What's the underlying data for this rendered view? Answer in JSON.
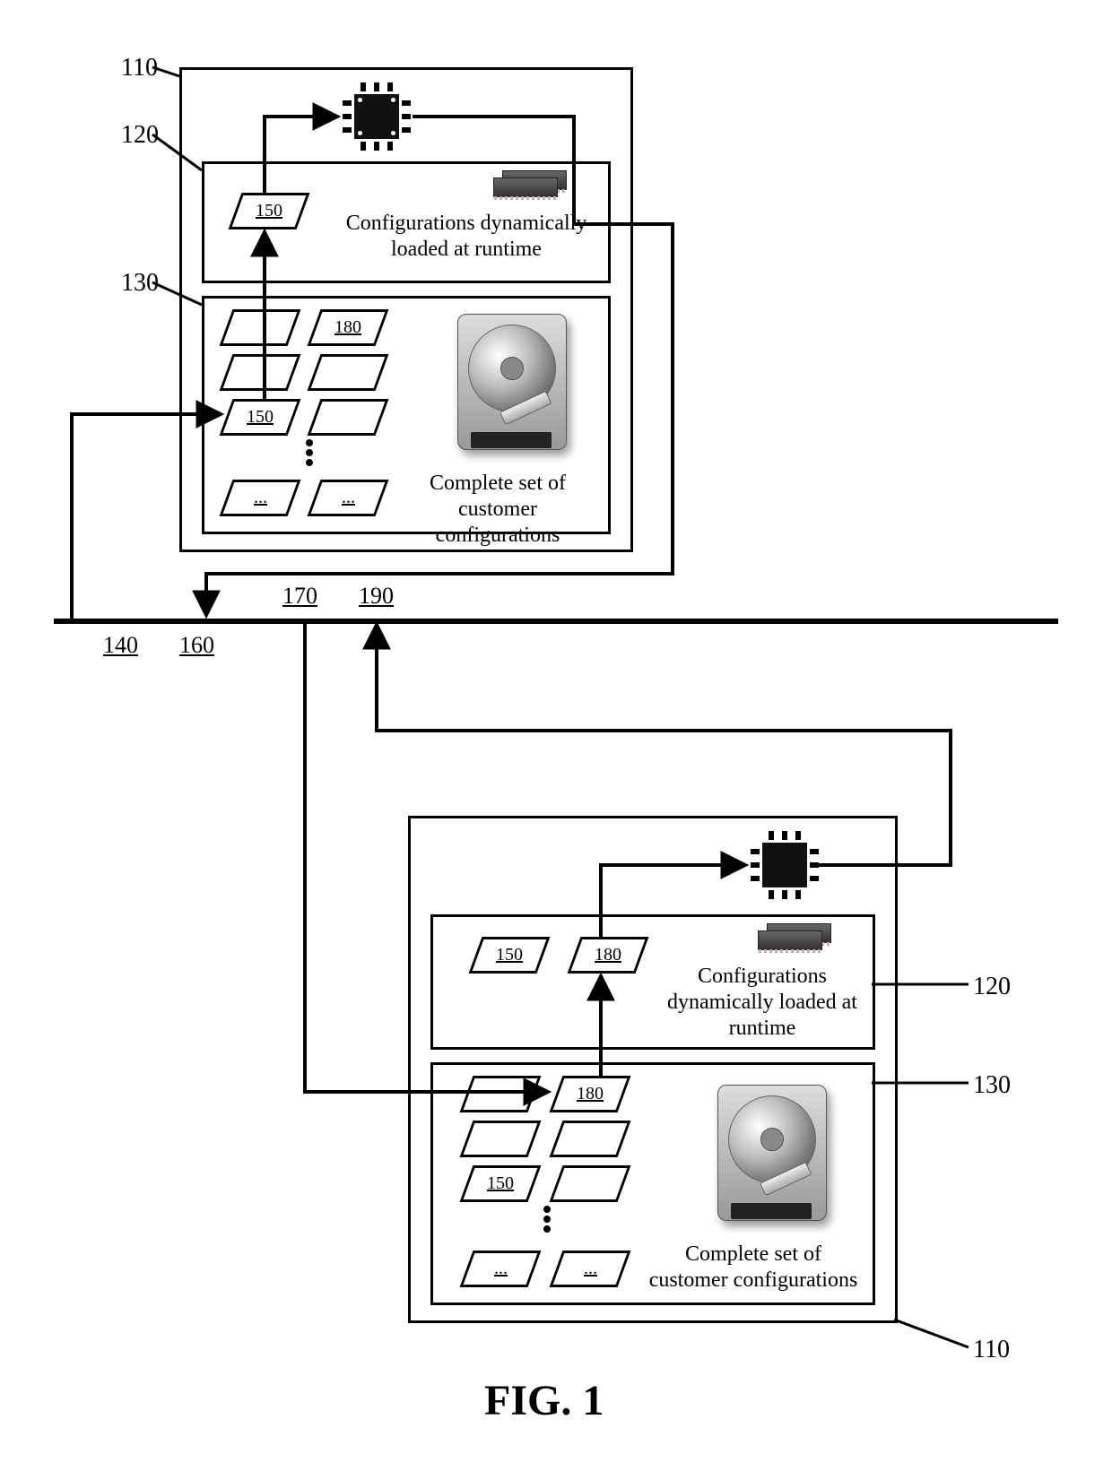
{
  "refs": {
    "r110a": "110",
    "r120a": "120",
    "r130a": "130",
    "r140": "140",
    "r160": "160",
    "r170": "170",
    "r190": "190",
    "r110b": "110",
    "r120b": "120",
    "r130b": "130"
  },
  "paras": {
    "p150_upper_mem": "150",
    "p180_upper_store": "180",
    "p150_upper_store": "150",
    "pdots1": "...",
    "pdots2": "...",
    "p150_lower_mem": "150",
    "p180_lower_mem": "180",
    "p180_lower_store": "180",
    "p150_lower_store": "150",
    "pdots3": "...",
    "pdots4": "..."
  },
  "captions": {
    "mem_upper": "Configurations dynamically\nloaded at runtime",
    "store_upper": "Complete set of\ncustomer configurations",
    "mem_lower": "Configurations\ndynamically loaded at\nruntime",
    "store_lower": "Complete set of\ncustomer configurations"
  },
  "figure": "FIG. 1"
}
